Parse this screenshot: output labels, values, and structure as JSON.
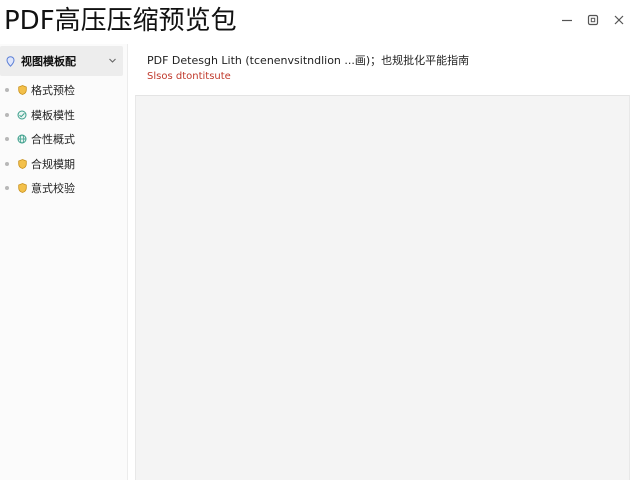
{
  "window": {
    "title": "PDF高压压缩预览包",
    "controls": {
      "minimize_icon": "minimize-icon",
      "restore_icon": "restore-icon",
      "close_icon": "close-icon"
    }
  },
  "sidebar": {
    "group": {
      "label": "视图模板配",
      "icon": "pin-icon",
      "expanded": true
    },
    "items": [
      {
        "label": "格式预检",
        "icon": "shield-icon",
        "icon_color": "#e0a526"
      },
      {
        "label": "模板模性",
        "icon": "gauge-icon",
        "icon_color": "#3a9e8a"
      },
      {
        "label": "合性概式",
        "icon": "globe-icon",
        "icon_color": "#3a9e8a"
      },
      {
        "label": "合规模期",
        "icon": "shield-icon",
        "icon_color": "#e0a526"
      },
      {
        "label": "意式校验",
        "icon": "shield-icon",
        "icon_color": "#e0a526"
      }
    ]
  },
  "document": {
    "title": "PDF Detesgh Lith (tcenenvsitndlion ...画)；也规批化平能指南",
    "meta": "Slsos  dtontitsute"
  },
  "colors": {
    "accent_warning": "#c0392b",
    "sidebar_bg": "#fbfbfb",
    "preview_bg": "#f4f4f4"
  }
}
